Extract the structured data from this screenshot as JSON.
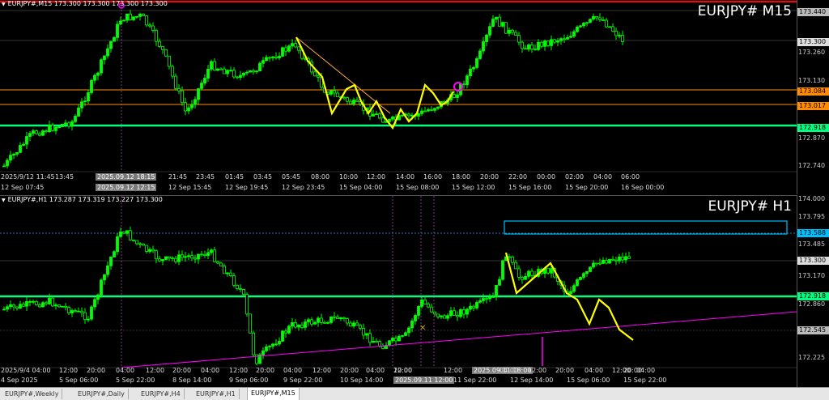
{
  "top": {
    "header": "EURJPY#,M15  173.300 173.300 173.300 173.300",
    "watermark": "EURJPY# M15",
    "price_labels": [
      "173.440",
      "173.300",
      "173.260",
      "173.130",
      "173.084",
      "173.017",
      "172.918",
      "172.870",
      "172.740"
    ],
    "time_labels_row1": [
      "2025/9/12 11:45",
      "13:45",
      "2025.09.12 18:15",
      "21:45",
      "23:45",
      "01:45",
      "03:45",
      "05:45",
      "08:00",
      "10:00",
      "12:00",
      "14:00",
      "16:00",
      "18:00",
      "20:00",
      "22:00",
      "00:00",
      "02:00",
      "04:00",
      "06:00"
    ],
    "time_labels_row2": [
      "12 Sep 07:45",
      "2025.09.12 12:15",
      "12 Sep 15:45",
      "12 Sep 19:45",
      "12 Sep 23:45",
      "15 Sep 04:00",
      "15 Sep 08:00",
      "15 Sep 12:00",
      "15 Sep 16:00",
      "15 Sep 20:00",
      "16 Sep 00:00"
    ]
  },
  "bottom": {
    "header": "EURJPY#,H1  173.287 173.319 173.227 173.300",
    "watermark": "EURJPY# H1",
    "price_labels": [
      "174.000",
      "173.795",
      "173.588",
      "173.485",
      "173.300",
      "173.170",
      "172.918",
      "172.860",
      "172.545",
      "172.225"
    ],
    "time_labels_row1": [
      "2025/9/4 04:00",
      "12:00",
      "20:00",
      "04:00",
      "12:00",
      "20:00",
      "04:00",
      "12:00",
      "20:00",
      "04:00",
      "12:00",
      "20:00",
      "04:00",
      "12:00",
      "20:00",
      "04:00",
      "12:00",
      "2025.09.11 18:00",
      "04:00",
      "12:00",
      "20:00",
      "04:00",
      "12:00",
      "20:00",
      "04:00"
    ],
    "time_labels_row2": [
      "4 Sep 2025",
      "5 Sep 06:00",
      "5 Sep 22:00",
      "8 Sep 14:00",
      "9 Sep 06:00",
      "9 Sep 22:00",
      "10 Sep 14:00",
      "2025.09.11 12:00",
      "11 Sep 22:00",
      "12 Sep 14:00",
      "15 Sep 06:00",
      "15 Sep 22:00"
    ]
  },
  "tabs": [
    "EURJPY#,Weekly",
    "EURJPY#,Daily",
    "EURJPY#,H4",
    "EURJPY#,H1",
    "EURJPY#,M15"
  ],
  "active_tab": "EURJPY#,M15",
  "colors": {
    "green_line": "#00ff7f",
    "orange_line": "#ff8c00",
    "red_line": "#ff0000",
    "yellow_draw": "#ffff00",
    "magenta_line": "#ff00ff",
    "cyan_box": "#00bfff",
    "candle": "#00ff00"
  }
}
